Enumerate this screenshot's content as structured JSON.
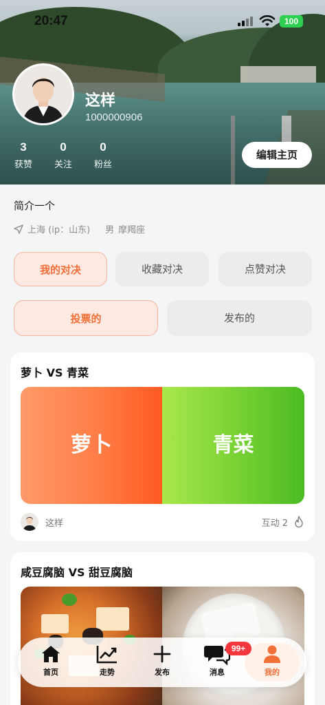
{
  "status_bar": {
    "time": "20:47",
    "battery": "100"
  },
  "profile": {
    "nickname": "这样",
    "user_id": "1000000906",
    "stats": [
      {
        "value": "3",
        "label": "获赞"
      },
      {
        "value": "0",
        "label": "关注"
      },
      {
        "value": "0",
        "label": "粉丝"
      }
    ],
    "edit_label": "编辑主页",
    "bio": "简介一个",
    "location": "上海 (ip：山东)",
    "gender": "男",
    "zodiac": "摩羯座"
  },
  "tabs": [
    {
      "label": "我的对决",
      "active": true
    },
    {
      "label": "收藏对决",
      "active": false
    },
    {
      "label": "点赞对决",
      "active": false
    }
  ],
  "sub_tabs": [
    {
      "label": "投票的",
      "active": true
    },
    {
      "label": "发布的",
      "active": false
    }
  ],
  "cards": [
    {
      "title": "萝卜 VS 青菜",
      "left": "萝卜",
      "right": "青菜",
      "author": "这样",
      "interact": "互动 2"
    },
    {
      "title": "咸豆腐脑 VS 甜豆腐脑"
    }
  ],
  "nav": {
    "items": [
      {
        "label": "首页",
        "icon": "home-icon"
      },
      {
        "label": "走势",
        "icon": "trend-icon"
      },
      {
        "label": "发布",
        "icon": "plus-icon"
      },
      {
        "label": "消息",
        "icon": "message-icon"
      },
      {
        "label": "我的",
        "icon": "person-icon"
      }
    ],
    "badge": "99+",
    "active": "我的"
  },
  "colors": {
    "accent": "#f26f38",
    "left_option": "#ff7a42",
    "right_option": "#62c62a",
    "badge": "#f3373c"
  }
}
